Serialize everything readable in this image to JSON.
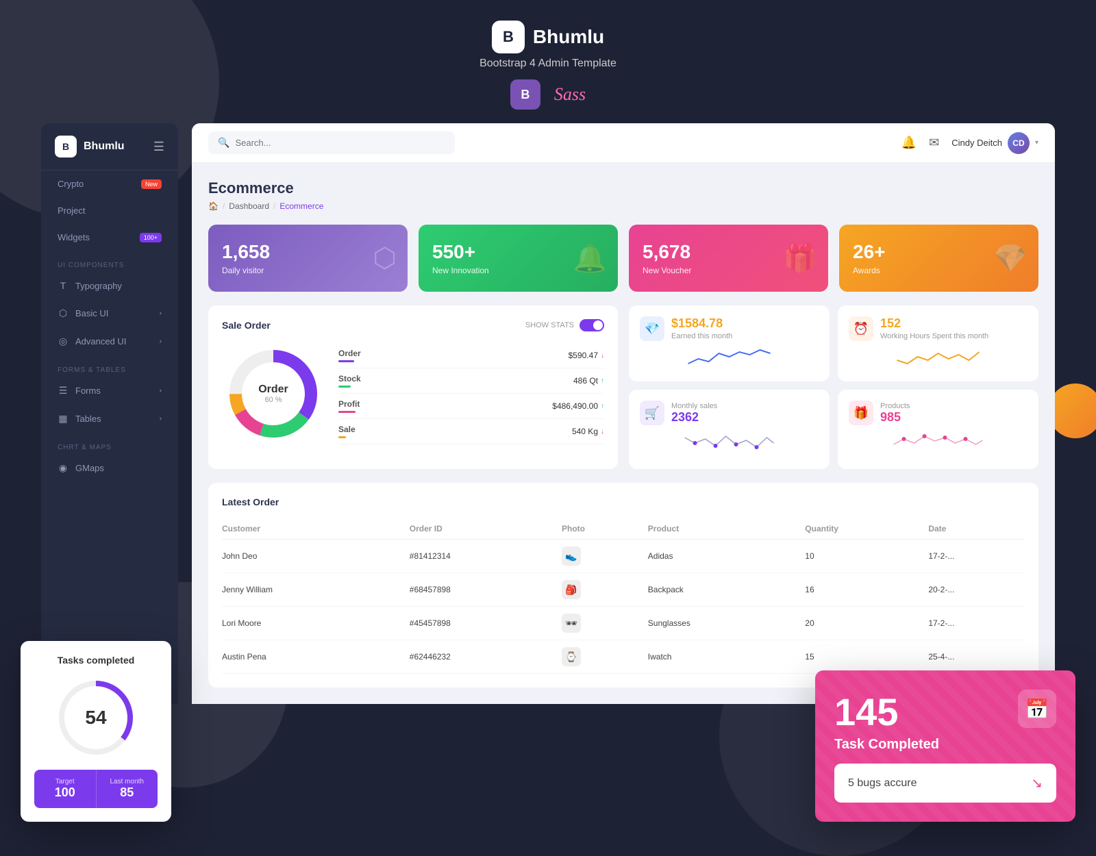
{
  "app": {
    "name": "Bhumlu",
    "tagline": "Bootstrap 4 Admin Template"
  },
  "topnav": {
    "search_placeholder": "Search...",
    "user_name": "Cindy Deitch",
    "user_initials": "CD"
  },
  "sidebar": {
    "brand": "Bhumlu",
    "items": [
      {
        "label": "Crypto",
        "badge": "New",
        "badge_type": "new"
      },
      {
        "label": "Project",
        "badge": "",
        "badge_type": ""
      },
      {
        "label": "Widgets",
        "badge": "100+",
        "badge_type": "count"
      }
    ],
    "sections": [
      {
        "title": "UI Components",
        "items": [
          {
            "label": "Typography",
            "icon": "T",
            "has_arrow": false
          },
          {
            "label": "Basic UI",
            "icon": "⬡",
            "has_arrow": true
          },
          {
            "label": "Advanced UI",
            "icon": "◎",
            "has_arrow": true
          }
        ]
      },
      {
        "title": "Forms & Tables",
        "items": [
          {
            "label": "Forms",
            "icon": "☰",
            "has_arrow": true
          },
          {
            "label": "Tables",
            "icon": "▦",
            "has_arrow": true
          }
        ]
      },
      {
        "title": "Chrt & Maps",
        "items": [
          {
            "label": "GMaps",
            "icon": "◉",
            "has_arrow": false
          }
        ]
      }
    ]
  },
  "breadcrumb": {
    "home": "🏠",
    "dashboard": "Dashboard",
    "current": "Ecommerce"
  },
  "page_title": "Ecommerce",
  "stat_cards": [
    {
      "value": "1,658",
      "label": "Daily visitor",
      "deco": "⬡"
    },
    {
      "value": "550+",
      "label": "New Innovation",
      "deco": "🔔"
    },
    {
      "value": "5,678",
      "label": "New Voucher",
      "deco": "🎁"
    },
    {
      "value": "26+",
      "label": "Awards",
      "deco": "💎"
    }
  ],
  "sale_order": {
    "title": "Sale Order",
    "show_stats_label": "SHOW STATS",
    "donut_label": "Order",
    "donut_value": "60 %",
    "rows": [
      {
        "label": "Order",
        "value": "$590.47",
        "direction": "down",
        "bar_class": "bar-purple"
      },
      {
        "label": "Stock",
        "value": "486 Qt",
        "direction": "up",
        "bar_class": "bar-green"
      },
      {
        "label": "Profit",
        "value": "$486,490.00",
        "direction": "up",
        "bar_class": "bar-red"
      },
      {
        "label": "Sale",
        "value": "540 Kg",
        "direction": "down",
        "bar_class": "bar-orange"
      }
    ]
  },
  "mini_stats": [
    {
      "icon": "💎",
      "icon_class": "icon-blue",
      "highlight": "$1584.78",
      "label": "Earned this month",
      "sparkline": "up"
    },
    {
      "icon": "⏰",
      "icon_class": "icon-orange",
      "highlight": "152",
      "label": "Working Hours Spent this month",
      "sparkline": "up"
    },
    {
      "icon": "🛒",
      "icon_class": "icon-purple",
      "highlight": "2362",
      "label": "Monthly sales",
      "sparkline": "down"
    },
    {
      "icon": "🎁",
      "icon_class": "icon-pink",
      "highlight": "985",
      "label": "Products",
      "sparkline": "up"
    }
  ],
  "latest_order": {
    "title": "Latest Order",
    "columns": [
      "Customer",
      "Order ID",
      "Photo",
      "Product",
      "Quantity",
      "Date"
    ],
    "rows": [
      {
        "customer": "John Deo",
        "order_id": "#81412314",
        "photo": "👟",
        "product": "Adidas",
        "quantity": "10",
        "date": "17-2-..."
      },
      {
        "customer": "Jenny William",
        "order_id": "#68457898",
        "photo": "🎒",
        "product": "Backpack",
        "quantity": "16",
        "date": "20-2-..."
      },
      {
        "customer": "Lori Moore",
        "order_id": "#45457898",
        "photo": "🕶",
        "product": "Sunglasses",
        "quantity": "20",
        "date": "17-2-..."
      },
      {
        "customer": "Austin Pena",
        "order_id": "#62446232",
        "photo": "⌚",
        "product": "Iwatch",
        "quantity": "15",
        "date": "25-4-..."
      }
    ]
  },
  "tasks_card": {
    "title": "Tasks completed",
    "current": "54",
    "target_label": "Target",
    "target_value": "100",
    "last_month_label": "Last month",
    "last_month_value": "85"
  },
  "task_completed": {
    "number": "145",
    "label": "Task Completed",
    "bugs_text": "5 bugs accure"
  }
}
